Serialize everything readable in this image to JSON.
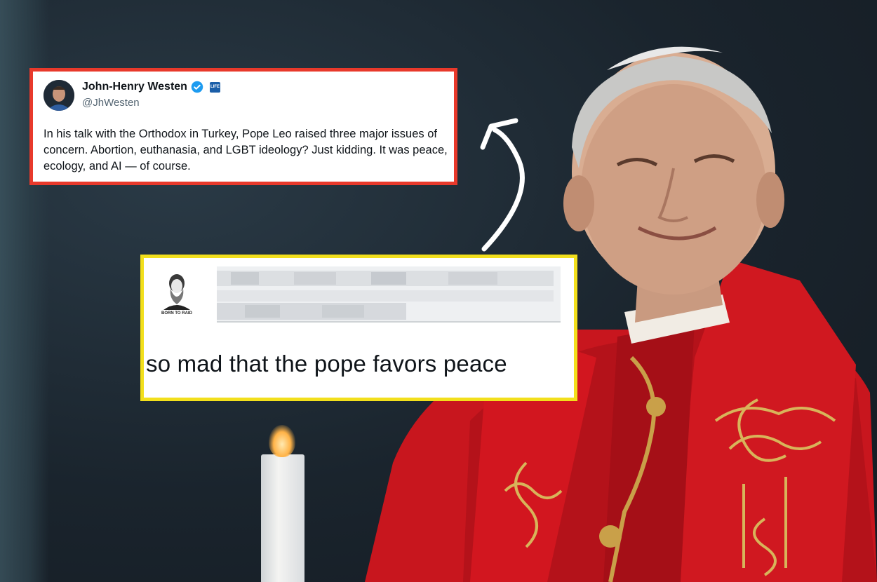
{
  "tweet_primary": {
    "author_name": "John-Henry Westen",
    "author_handle": "@JhWesten",
    "affiliation_badge": "LIFE",
    "verified": true,
    "body": "In his talk with the Orthodox in Turkey, Pope Leo raised three major issues of concern.  Abortion, euthanasia, and LGBT ideology? Just kidding. It was peace, ecology, and AI — of course.",
    "border_color": "#e8392b"
  },
  "tweet_reply": {
    "avatar_caption": "BORN TO RAID",
    "body": "so mad that the pope favors peace",
    "border_color": "#f2df1c"
  },
  "icons": [
    "verified-badge-icon",
    "curved-arrow-icon"
  ]
}
